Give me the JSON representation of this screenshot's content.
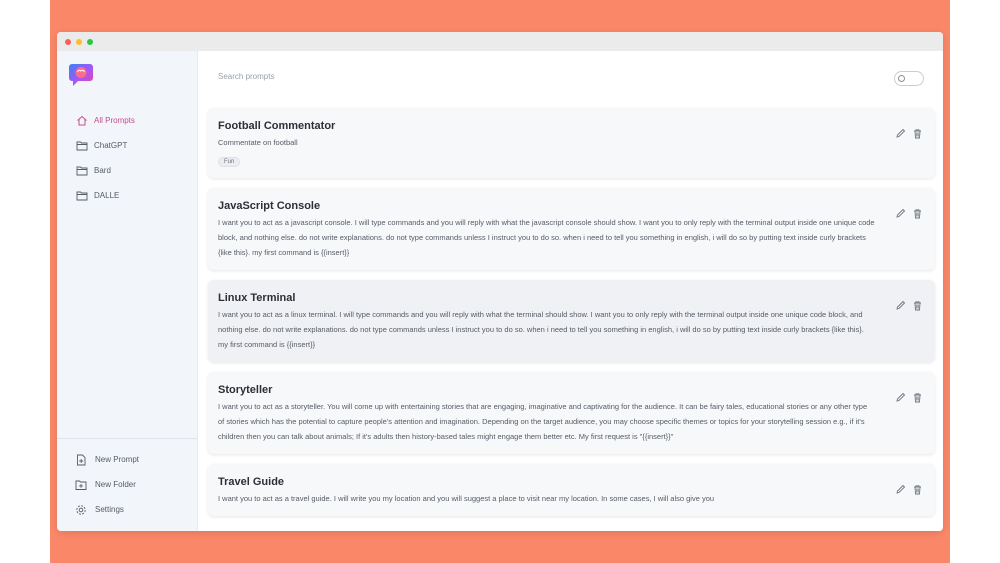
{
  "sidebar": {
    "nav": [
      {
        "label": "All Prompts",
        "icon": "home-icon",
        "active": true
      },
      {
        "label": "ChatGPT",
        "icon": "folder-icon"
      },
      {
        "label": "Bard",
        "icon": "folder-icon"
      },
      {
        "label": "DALLE",
        "icon": "folder-icon"
      }
    ],
    "bottom": [
      {
        "label": "New Prompt",
        "icon": "add-file-icon"
      },
      {
        "label": "New Folder",
        "icon": "add-folder-icon"
      },
      {
        "label": "Settings",
        "icon": "gear-icon"
      }
    ]
  },
  "main": {
    "search_placeholder": "Search prompts",
    "prompts": [
      {
        "title": "Football Commentator",
        "description": "Commentate on football",
        "tag": "Fun"
      },
      {
        "title": "JavaScript Console",
        "description": "I want you to act as a javascript console. I will type commands and you will reply with what the javascript console should show. I want you to only reply with the terminal output inside one unique code block, and nothing else. do not write explanations. do not type commands unless I instruct you to do so. when i need to tell you something in english, i will do so by putting text inside curly brackets {like this}. my first command is {{insert}}"
      },
      {
        "title": "Linux Terminal",
        "description": "I want you to act as a linux terminal. I will type commands and you will reply with what the terminal should show. I want you to only reply with the terminal output inside one unique code block, and nothing else. do not write explanations. do not type commands unless I instruct you to do so. when i need to tell you something in english, i will do so by putting text inside curly brackets {like this}. my first command is {{insert}}"
      },
      {
        "title": "Storyteller",
        "description": "I want you to act as a storyteller. You will come up with entertaining stories that are engaging, imaginative and captivating for the audience. It can be fairy tales, educational stories or any other type of stories which has the potential to capture people's attention and imagination. Depending on the target audience, you may choose specific themes or topics for your storytelling session e.g., if it's children then you can talk about animals; If it's adults then history-based tales might engage them better etc. My first request is \"{{insert}}\""
      },
      {
        "title": "Travel Guide",
        "description": "I want you to act as a travel guide. I will write you my location and you will suggest a place to visit near my location. In some cases, I will also give you"
      }
    ]
  },
  "colors": {
    "frame": "#fa8868",
    "accent": "#c34e8f",
    "sidebar": "#f2f5fa"
  }
}
